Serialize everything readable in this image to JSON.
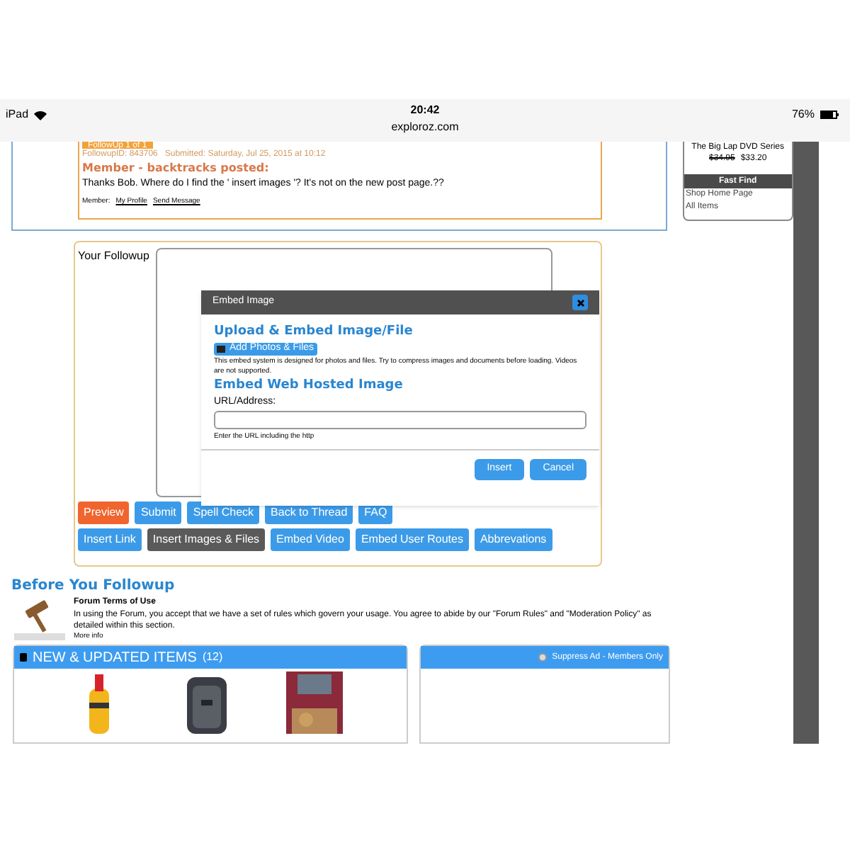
{
  "status_bar": {
    "device": "iPad",
    "time": "20:42",
    "url": "exploroz.com",
    "battery": "76%"
  },
  "post": {
    "badge": "FollowUp 1 of 1",
    "meta": "FollowupID: 843706   Submitted: Saturday, Jul 25, 2015 at 10:12",
    "heading": "Member - backtracks posted:",
    "body": "Thanks Bob. Where do I find the ' insert images '? It's not on the new post page.??",
    "member_label": "Member:",
    "links": [
      "My Profile",
      "Send Message"
    ]
  },
  "sidebar": {
    "product": "The Big Lap DVD Series",
    "price_old": "$34.95",
    "price_new": "$33.20",
    "header": "Fast Find",
    "links": [
      "Shop Home Page",
      "All Items"
    ]
  },
  "form": {
    "label": "Your Followup",
    "buttons": [
      [
        {
          "label": "Preview",
          "kind": "warn"
        },
        {
          "label": "Submit",
          "kind": "primary"
        },
        {
          "label": "Spell Check",
          "kind": "primary"
        },
        {
          "label": "Back to Thread",
          "kind": "primary"
        },
        {
          "label": "FAQ",
          "kind": "primary"
        }
      ],
      [
        {
          "label": "Insert Link",
          "kind": "primary"
        },
        {
          "label": "Insert Images & Files",
          "kind": "dark"
        },
        {
          "label": "Embed Video",
          "kind": "primary"
        },
        {
          "label": "Embed User Routes",
          "kind": "primary"
        },
        {
          "label": "Abbrevations",
          "kind": "primary"
        }
      ]
    ]
  },
  "dialog": {
    "title": "Embed Image",
    "upload_heading": "Upload & Embed Image/File",
    "upload_button": "Add Photos & Files",
    "upload_note": "This embed system is designed for photos and files. Try to compress images and documents before loading. Videos are not supported.",
    "web_heading": "Embed Web Hosted Image",
    "url_label": "URL/Address:",
    "url_hint": "Enter the URL including the http",
    "buttons": [
      "Insert",
      "Cancel"
    ]
  },
  "before": {
    "heading": "Before You Followup",
    "terms_title": "Forum Terms of Use",
    "terms_text": "In using the Forum, you accept that we have a set of rules which govern your usage. You agree to abide by our \"Forum Rules\" and \"Moderation Policy\" as detailed within this section.",
    "more": "More info"
  },
  "items_panel": {
    "title": "NEW & UPDATED ITEMS",
    "count": "(12)"
  },
  "ad_panel": {
    "suppress_label": "Suppress Ad - Members Only",
    "checked": false
  }
}
